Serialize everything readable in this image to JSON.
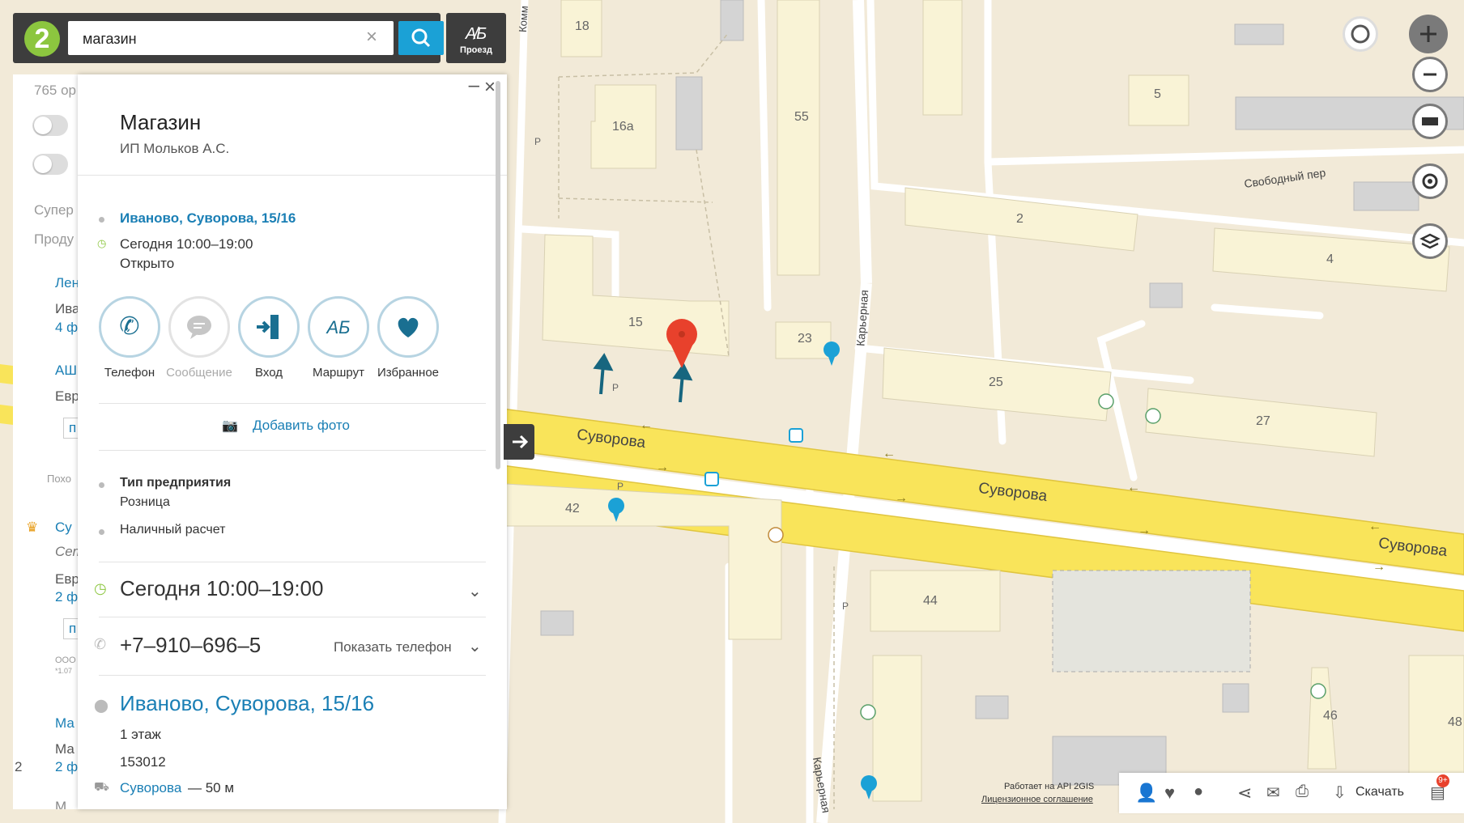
{
  "search": {
    "value": "магазин",
    "clear_icon": "close-icon",
    "route_label": "Проезд"
  },
  "list": {
    "count_partial": "765 ор",
    "filters": [
      "Супер",
      "Проду"
    ],
    "items": [
      {
        "title": "Лен",
        "sub": "Ива",
        "branches": "4 ф"
      },
      {
        "title": "АШ",
        "sub": "Евр",
        "btn": "п"
      },
      {
        "section": "Похо"
      },
      {
        "title": "Су",
        "sub": "Сет",
        "sub2": "Евр",
        "branches": "2 ф",
        "btn": "п",
        "small": "ООО",
        "small2": "*1.07"
      },
      {
        "title": "Ма",
        "sub": "Ма",
        "branches": "2 ф"
      },
      {
        "title": "М",
        "mark": "2"
      }
    ]
  },
  "card": {
    "title": "Магазин",
    "subtitle": "ИП Мольков А.С.",
    "address_link": "Иваново, Суворова, 15/16",
    "hours_short": "Сегодня 10:00–19:00",
    "status": "Открыто",
    "actions": [
      {
        "label": "Телефон",
        "icon": "phone-icon",
        "enabled": true
      },
      {
        "label": "Сообщение",
        "icon": "message-icon",
        "enabled": false
      },
      {
        "label": "Вход",
        "icon": "entrance-icon",
        "enabled": true
      },
      {
        "label": "Маршрут",
        "icon": "route-icon",
        "enabled": true
      },
      {
        "label": "Избранное",
        "icon": "heart-icon",
        "enabled": true
      }
    ],
    "add_photo": "Добавить фото",
    "type_title": "Тип предприятия",
    "type_value": "Розница",
    "payment": "Наличный расчет",
    "hours_full": "Сегодня 10:00–19:00",
    "phone": "+7–910–696–5",
    "show_phone": "Показать телефон",
    "address_full": "Иваново, Суворова, 15/16",
    "floor": "1 этаж",
    "postcode": "153012",
    "stop_name": "Суворова",
    "stop_distance": "— 50 м"
  },
  "map": {
    "streets": [
      "Суворова",
      "Суворова",
      "Суворова",
      "Карьерная",
      "Карьерная",
      "Свободный пер",
      "Комм"
    ],
    "buildings": [
      "18",
      "16а",
      "55",
      "5",
      "2",
      "4",
      "15",
      "23",
      "25",
      "27",
      "42",
      "44",
      "46",
      "48"
    ],
    "parking": "Р"
  },
  "footer": {
    "credit_line1": "Работает на API 2GIS",
    "credit_line2": "Лицензионное соглашение",
    "download": "Скачать",
    "badge": "9+"
  },
  "colors": {
    "accent": "#1ba1d6",
    "road_yellow": "#f9e45a",
    "pin_red": "#e8412c",
    "open_green": "#8cc63f",
    "link": "#1a7fb5"
  }
}
